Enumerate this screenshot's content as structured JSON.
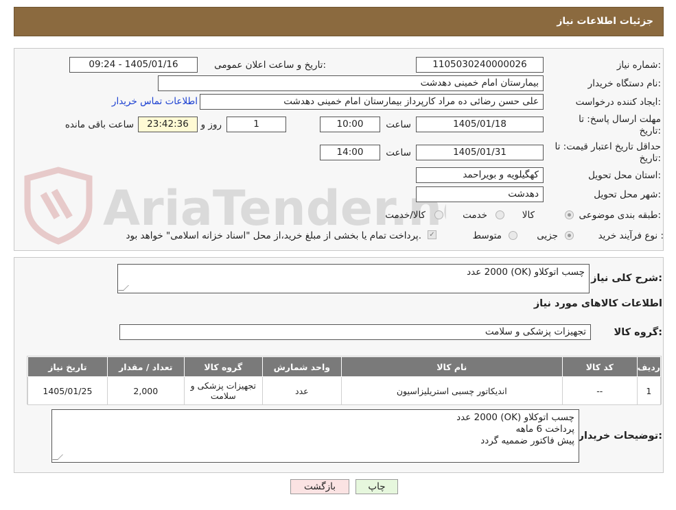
{
  "header": {
    "title": "جزئیات اطلاعات نیاز"
  },
  "watermark": {
    "text": "AriaTender.neT"
  },
  "form": {
    "need_number_label": "شماره نیاز:",
    "need_number": "1105030240000026",
    "announce_label": "تاریخ و ساعت اعلان عمومی:",
    "announce_value": "1405/01/16 - 09:24",
    "buyer_org_label": "نام دستگاه خریدار:",
    "buyer_org": "بیمارستان امام خمینی دهدشت",
    "creator_label": "ایجاد کننده درخواست:",
    "creator": "علی حسن رضائی ده مراد کارپرداز بیمارستان امام خمینی دهدشت",
    "contact_link": "اطلاعات تماس خریدار",
    "deadline_label_1": "مهلت ارسال پاسخ: تا",
    "deadline_label_2": "تاریخ:",
    "deadline_date": "1405/01/18",
    "time_label": "ساعت",
    "deadline_time": "10:00",
    "days": "1",
    "days_label": "روز و",
    "remaining": "23:42:36",
    "remaining_label": "ساعت باقی مانده",
    "validity_label_1": "حداقل تاریخ اعتبار قیمت: تا",
    "validity_label_2": "تاریخ:",
    "validity_date": "1405/01/31",
    "validity_time": "14:00",
    "province_label": "استان محل تحویل:",
    "province": "کهگیلویه و بویراحمد",
    "city_label": "شهر محل تحویل:",
    "city": "دهدشت",
    "category_label": "طبقه بندی موضوعی:",
    "category_options": [
      "کالا",
      "خدمت",
      "کالا/خدمت"
    ],
    "purchase_type_label": "نوع فرآیند خرید :",
    "purchase_options": [
      "جزیی",
      "متوسط"
    ],
    "payment_note": "پرداخت تمام یا بخشی از مبلغ خرید،از محل \"اسناد خزانه اسلامی\" خواهد بود."
  },
  "details": {
    "summary_label": "شرح کلی نیاز:",
    "summary": "چسب اتوکلاو (OK) 2000 عدد",
    "goods_info_title": "اطلاعات کالاهای مورد نیاز",
    "goods_group_label": "گروه کالا:",
    "goods_group": "تجهیزات پزشکی و سلامت",
    "table": {
      "headers": [
        "ردیف",
        "کد کالا",
        "نام کالا",
        "واحد شمارش",
        "گروه کالا",
        "تعداد / مقدار",
        "تاریخ نیاز"
      ],
      "rows": [
        [
          "1",
          "--",
          "اندیکاتور چسبی استریلیزاسیون",
          "عدد",
          "تجهیزات پزشکی و سلامت",
          "2,000",
          "1405/01/25"
        ]
      ]
    },
    "buyer_notes_label": "توضیحات خریدار:",
    "buyer_notes": [
      "چسب اتوکلاو (OK) 2000 عدد",
      "پرداخت 6 ماهه",
      "پیش فاکتور ضممیه گردد"
    ]
  },
  "buttons": {
    "print": "چاپ",
    "back": "بازگشت"
  },
  "colors": {
    "header": "#8b6a3f",
    "table_header": "#7a7a7a",
    "back_button": "#fbe3e3",
    "print_button": "#e6f7dd",
    "link": "#1a3fd1"
  }
}
